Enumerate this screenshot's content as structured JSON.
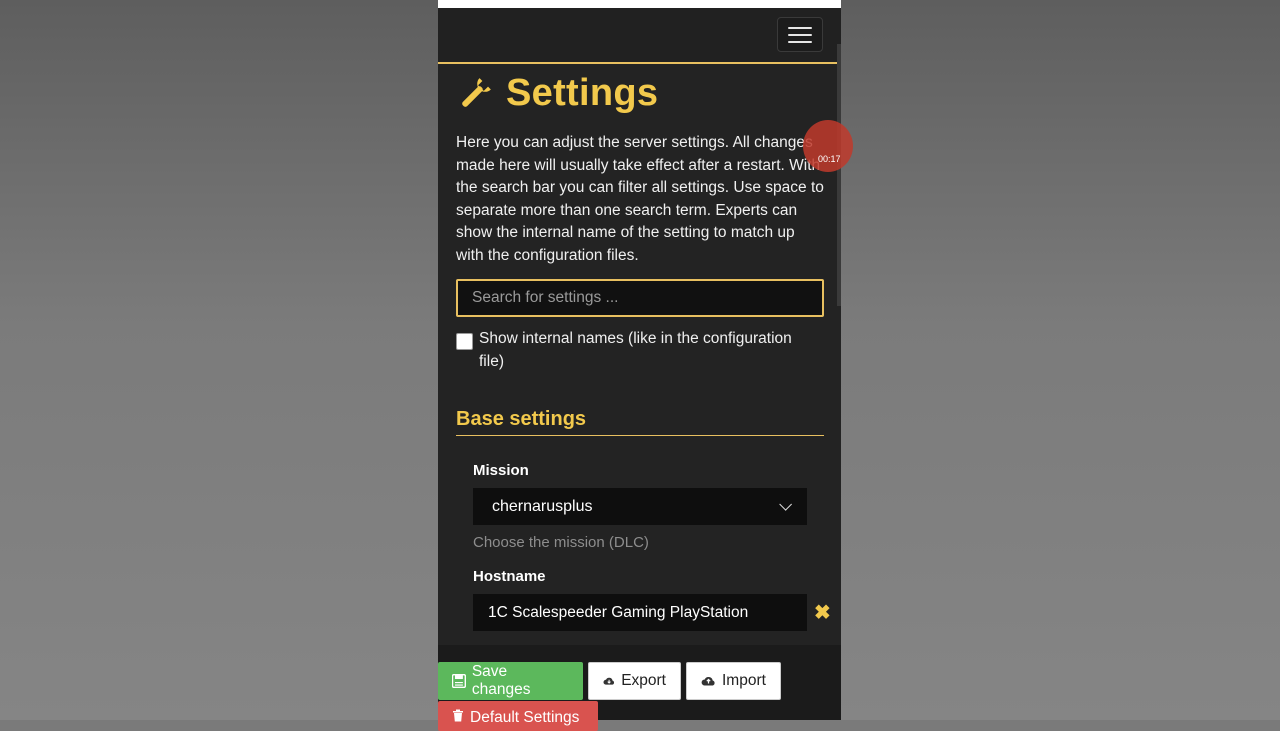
{
  "page": {
    "title": "Settings",
    "intro": "Here you can adjust the server settings. All changes made here will usually take effect after a restart. With the search bar you can filter all settings. Use space to separate more than one search term. Experts can show the internal name of the setting to match up with the configuration files.",
    "search_placeholder": "Search for settings ...",
    "show_internal_label": "Show internal names (like in the configuration file)",
    "show_internal_checked": false
  },
  "section": {
    "title": "Base settings"
  },
  "fields": {
    "mission": {
      "label": "Mission",
      "value": "chernarusplus",
      "help": "Choose the mission (DLC)"
    },
    "hostname": {
      "label": "Hostname",
      "value": "1C Scalespeeder Gaming PlayStation"
    }
  },
  "actions": {
    "save": "Save changes",
    "export": "Export",
    "import": "Import",
    "defaults": "Default Settings"
  },
  "overlay": {
    "rec_time": "00:17"
  },
  "colors": {
    "accent": "#f2c94c",
    "save": "#5cb85c",
    "danger": "#d9534f",
    "background": "#232323"
  },
  "icons": [
    "wrench-icon",
    "menu-icon",
    "save-icon",
    "cloud-download-icon",
    "cloud-upload-icon",
    "trash-icon",
    "close-icon",
    "chevron-down-icon"
  ]
}
